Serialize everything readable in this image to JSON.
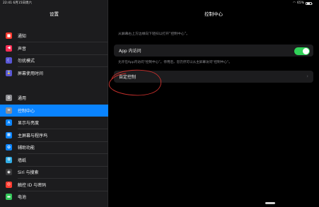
{
  "status": {
    "time_date": "22:41  6月15日周六",
    "battery_pct": "65%",
    "battery_level": 0.65,
    "wifi_icon": "wifi-icon"
  },
  "sidebar": {
    "title": "设置",
    "groups": [
      {
        "items": [
          {
            "label": "通知",
            "icon": "bell-icon",
            "color": "#ff3b30",
            "glyph": "■"
          },
          {
            "label": "声音",
            "icon": "speaker-icon",
            "color": "#ff2d55",
            "glyph": "◀"
          },
          {
            "label": "勿扰模式",
            "icon": "moon-icon",
            "color": "#5856d6",
            "glyph": "☾"
          },
          {
            "label": "屏幕使用时间",
            "icon": "hourglass-icon",
            "color": "#5856d6",
            "glyph": "⌛"
          }
        ]
      },
      {
        "items": [
          {
            "label": "通用",
            "icon": "gear-icon",
            "color": "#8e8e93",
            "glyph": "⚙"
          },
          {
            "label": "控制中心",
            "icon": "switches-icon",
            "color": "#8e8e93",
            "glyph": "≡",
            "selected": true
          },
          {
            "label": "显示与亮度",
            "icon": "brightness-icon",
            "color": "#0a84ff",
            "glyph": "A"
          },
          {
            "label": "主屏幕与程序坞",
            "icon": "home-grid-icon",
            "color": "#0a84ff",
            "glyph": "▦"
          },
          {
            "label": "辅助功能",
            "icon": "accessibility-icon",
            "color": "#0a84ff",
            "glyph": "✪"
          },
          {
            "label": "墙纸",
            "icon": "flower-icon",
            "color": "#32ade6",
            "glyph": "✿"
          },
          {
            "label": "Siri 与搜索",
            "icon": "siri-icon",
            "color": "#3a3a3c",
            "glyph": "◉"
          },
          {
            "label": "触控 ID 与密码",
            "icon": "fingerprint-icon",
            "color": "#ff3b30",
            "glyph": "◎"
          },
          {
            "label": "电池",
            "icon": "battery-icon",
            "color": "#34c759",
            "glyph": "▬"
          }
        ]
      }
    ]
  },
  "detail": {
    "title": "控制中心",
    "note": "从屏幕右上方边缘向下轻扫以打开“控制中心”。",
    "app_access_label": "App 内访问",
    "app_access_on": true,
    "app_access_footnote": "允许在App内访问“控制中心”。停用后，您仍然可以从主屏幕访问“控制中心”。",
    "customize_label": "自定控制",
    "chevron_icon": "chevron-right-icon",
    "annotation_color": "#c9302c"
  }
}
